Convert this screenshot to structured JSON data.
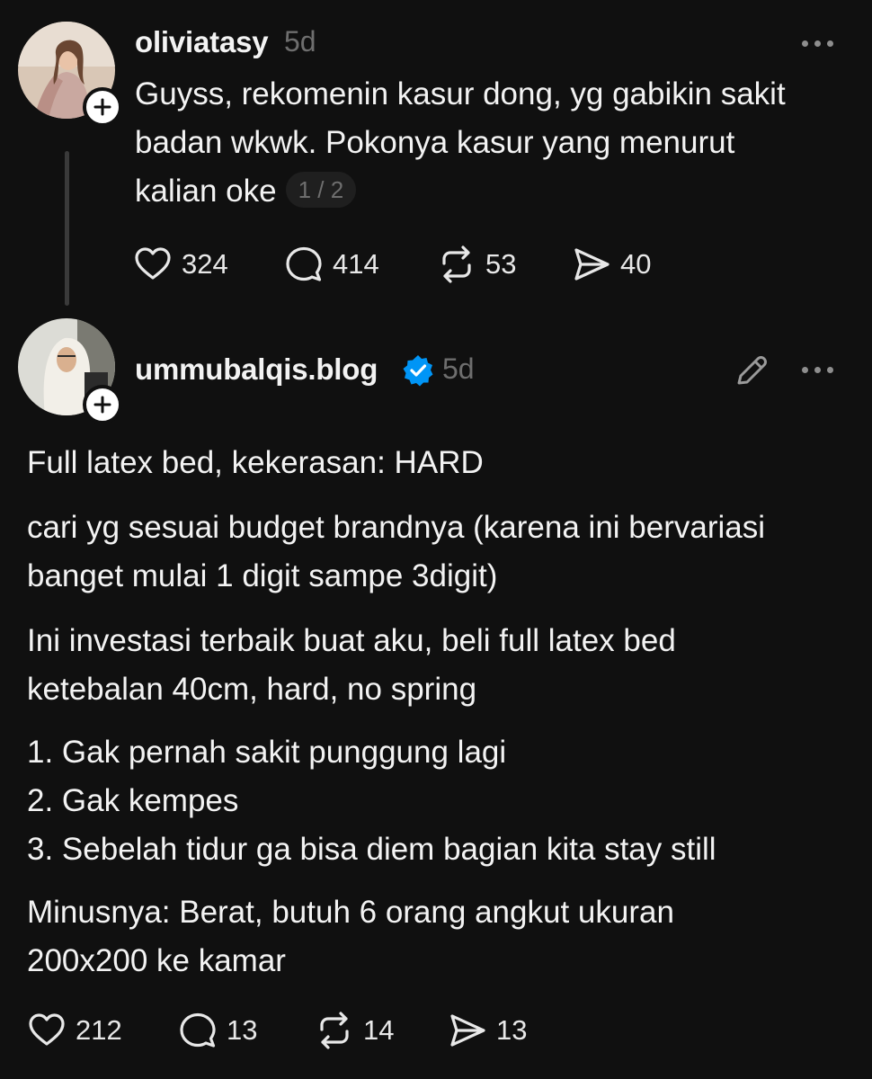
{
  "posts": [
    {
      "username": "oliviatasy",
      "time": "5d",
      "text": "Guyss, rekomenin kasur dong, yg gabikin sakit\nbadan wkwk. Pokonya kasur yang menurut\nkalian oke",
      "page_indicator": "1 / 2",
      "actions": {
        "likes": "324",
        "replies": "414",
        "reposts": "53",
        "shares": "40"
      }
    },
    {
      "username": "ummubalqis.blog",
      "verified": true,
      "time": "5d",
      "paragraphs": [
        "Full latex bed, kekerasan: HARD",
        "cari yg sesuai budget brandnya (karena ini bervariasi\nbanget mulai 1 digit sampe 3digit)",
        "Ini investasi terbaik buat aku, beli full latex bed\nketebalan 40cm, hard, no spring",
        "1. Gak pernah sakit punggung lagi\n2. Gak kempes\n3. Sebelah tidur ga bisa diem bagian kita stay still",
        "Minusnya: Berat, butuh 6 orang angkut ukuran\n200x200 ke kamar"
      ],
      "actions": {
        "likes": "212",
        "replies": "13",
        "reposts": "14",
        "shares": "13"
      }
    }
  ],
  "icons": {
    "like": "heart-icon",
    "reply": "comment-icon",
    "repost": "repost-icon",
    "share": "send-icon",
    "more": "more-options-icon",
    "edit": "pencil-icon",
    "follow": "plus-icon",
    "verified": "verified-badge-icon"
  },
  "colors": {
    "background": "#101010",
    "text": "#f3f3f3",
    "muted": "#6e6e6e",
    "verified": "#0095f6"
  }
}
